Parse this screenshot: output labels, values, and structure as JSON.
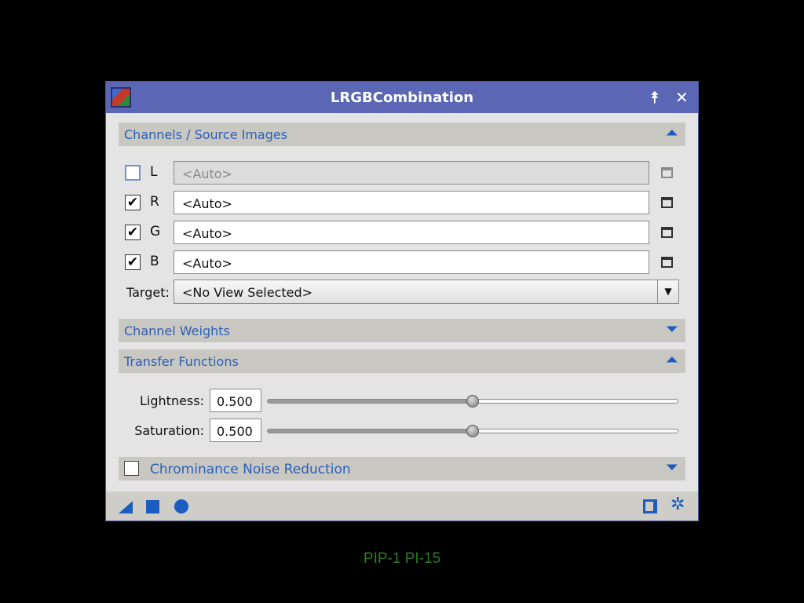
{
  "window": {
    "title": "LRGBCombination",
    "shade_icon": "⯭",
    "close_icon": "✕"
  },
  "sections": {
    "channels": {
      "label": "Channels / Source Images",
      "state": "expanded",
      "toggle_icon": "⏶"
    },
    "weights": {
      "label": "Channel Weights",
      "state": "collapsed",
      "toggle_icon": "⏷"
    },
    "transfer": {
      "label": "Transfer Functions",
      "state": "expanded",
      "toggle_icon": "⏶"
    },
    "chrominance": {
      "label": "Chrominance Noise Reduction",
      "state": "collapsed",
      "toggle_icon": "⏷",
      "enabled": false
    }
  },
  "channels": [
    {
      "id": "L",
      "label": "L",
      "checked": false,
      "value": "<Auto>",
      "enabled": false
    },
    {
      "id": "R",
      "label": "R",
      "checked": true,
      "value": "<Auto>",
      "enabled": true
    },
    {
      "id": "G",
      "label": "G",
      "checked": true,
      "value": "<Auto>",
      "enabled": true
    },
    {
      "id": "B",
      "label": "B",
      "checked": true,
      "value": "<Auto>",
      "enabled": true
    }
  ],
  "checkmark": "✔",
  "target": {
    "label": "Target:",
    "value": "<No View Selected>",
    "arrow": "▼"
  },
  "transfer": {
    "lightness": {
      "label": "Lightness:",
      "value": "0.500",
      "fraction": 0.5
    },
    "saturation": {
      "label": "Saturation:",
      "value": "0.500",
      "fraction": 0.5
    }
  },
  "bottom_icons": [
    "new-instance-icon",
    "apply-icon",
    "apply-global-icon",
    "documentation-icon",
    "reset-icon"
  ],
  "reset_glyph": "✲",
  "footer": "PIP-1 PI-15",
  "colors": {
    "titlebar": "#5b66b5",
    "accent": "#1b5cc0",
    "section_label": "#2b5fb8",
    "footer_text": "#2c7a28"
  }
}
